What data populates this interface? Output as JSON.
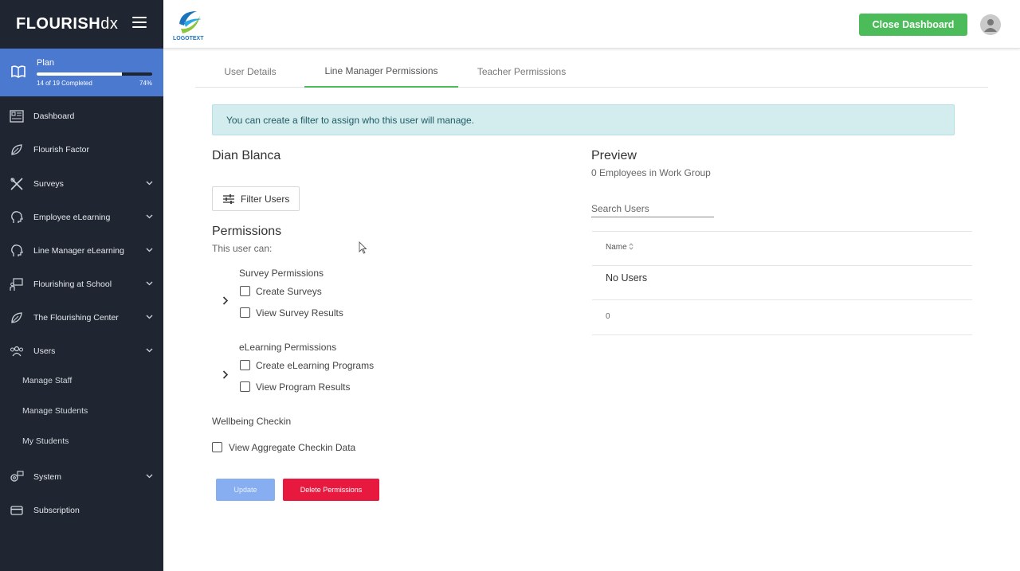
{
  "brand": {
    "bold": "FLOURISH",
    "light": "dx"
  },
  "plan": {
    "title": "Plan",
    "progress_text": "14 of 19 Completed",
    "percent_label": "74%",
    "progress": 0.74
  },
  "sidebar": {
    "items": [
      {
        "label": "Dashboard",
        "icon": "dashboard-icon"
      },
      {
        "label": "Flourish Factor",
        "icon": "leaf-icon"
      },
      {
        "label": "Surveys",
        "icon": "tools-icon"
      },
      {
        "label": "Employee eLearning",
        "icon": "head-icon"
      },
      {
        "label": "Line Manager eLearning",
        "icon": "head-icon"
      },
      {
        "label": "Flourishing at School",
        "icon": "school-icon"
      },
      {
        "label": "The Flourishing Center",
        "icon": "leaf-icon"
      },
      {
        "label": "Users",
        "icon": "users-icon"
      },
      {
        "label": "System",
        "icon": "system-icon"
      },
      {
        "label": "Subscription",
        "icon": "card-icon"
      }
    ],
    "users_sub": [
      "Manage Staff",
      "Manage Students",
      "My Students"
    ]
  },
  "header": {
    "logo_text": "LOGOTEXT",
    "close_label": "Close Dashboard"
  },
  "tabs": [
    "User Details",
    "Line Manager Permissions",
    "Teacher Permissions"
  ],
  "alert": "You can create a filter to assign who this user will manage.",
  "user_name": "Dian Blanca",
  "filter_label": "Filter Users",
  "permissions": {
    "title": "Permissions",
    "subtitle": "This user can:",
    "survey_group": "Survey Permissions",
    "survey_items": [
      "Create Surveys",
      "View Survey Results"
    ],
    "elearning_group": "eLearning Permissions",
    "elearning_items": [
      "Create eLearning Programs",
      "View Program Results"
    ],
    "wellbeing_group": "Wellbeing Checkin",
    "wellbeing_items": [
      "View Aggregate Checkin Data"
    ]
  },
  "preview": {
    "title": "Preview",
    "count_text": "0 Employees in Work Group",
    "search_placeholder": "Search Users",
    "col_name": "Name",
    "sort_icon": "sort-icon",
    "empty": "No Users",
    "footer_count": "0"
  },
  "buttons": {
    "update": "Update",
    "delete": "Delete Permissions"
  },
  "colors": {
    "sidebar": "#1f2631",
    "plan": "#4a79cf",
    "accent": "#4cbb5a",
    "danger": "#e8193f",
    "update": "#86aef0",
    "alert_bg": "#d3edef"
  }
}
